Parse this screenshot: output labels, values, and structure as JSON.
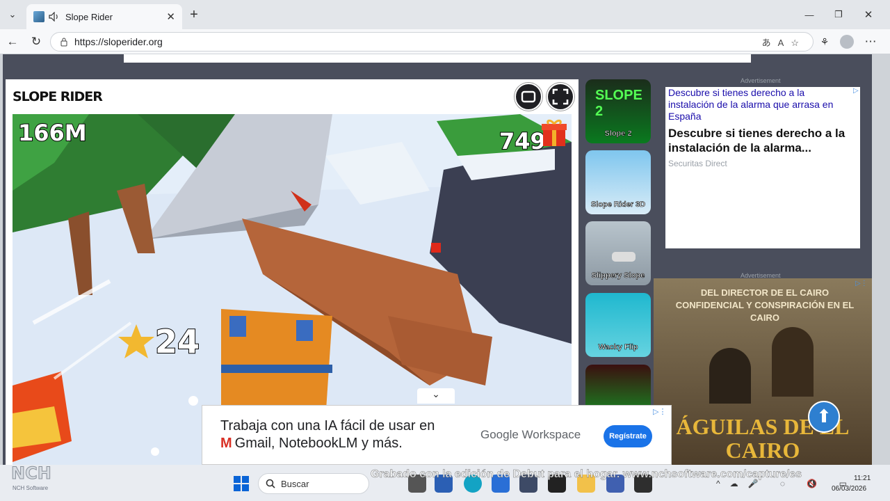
{
  "browser": {
    "tab_title": "Slope Rider",
    "url": "https://sloperider.org",
    "new_tab_symbol": "+",
    "close_symbol": "✕",
    "window_minimize": "—",
    "window_maximize": "❐",
    "window_close": "✕"
  },
  "game": {
    "logo": "SLOPE RIDER",
    "distance": "166M",
    "gifts": "749",
    "stars": "24"
  },
  "sidebar_games": [
    {
      "label": "Slope 2"
    },
    {
      "label": "Slope Rider 3D"
    },
    {
      "label": "Slippery Slope"
    },
    {
      "label": "Wacky Flip"
    }
  ],
  "ads": {
    "label": "Advertisement",
    "ad1_link": "Descubre si tienes derecho a la instalación de la alarma que arrasa en España",
    "ad1_headline": "Descubre si tienes derecho a la instalación de la alarma...",
    "ad1_advertiser": "Securitas Direct",
    "ad2_top": "DEL DIRECTOR DE EL CAIRO CONFIDENCIAL Y CONSPIRACIÓN EN EL CAIRO",
    "ad2_title": "ÁGUILAS DE EL CAIRO",
    "bottom_line1": "Trabaja con una IA fácil de usar en",
    "bottom_line2": "Gmail, NotebookLM y más.",
    "bottom_brand": "Google Workspace",
    "bottom_cta": "Regístrate"
  },
  "watermark": {
    "text": "Grabado con la edición de Debut para el hogar. www.nchsoftware.com/capture/es",
    "logo": "NCH",
    "logo_sub": "NCH Software"
  },
  "taskbar": {
    "search_placeholder": "Buscar",
    "time": "11:21",
    "date": "06/03/2026"
  }
}
